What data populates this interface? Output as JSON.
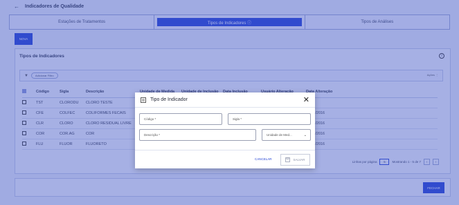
{
  "page": {
    "title": "Indicadores de Qualidade",
    "tabs": [
      {
        "label": "Estações de Tratamentos"
      },
      {
        "label": "Tipos de Indicadores ⓘ"
      },
      {
        "label": "Tipos de Análises"
      }
    ],
    "nova_label": "NOVA",
    "card_title": "Tipos de Indicadores",
    "filter_chip": "Adicionar Filtro",
    "acoes_label": "Ações",
    "columns": [
      "Código",
      "Sigla",
      "Descrição",
      "Unidade de Medida",
      "Unidade de Inclusão",
      "Data Inclusão",
      "Usuário Alteração",
      "Data Alteração"
    ],
    "rows": [
      {
        "codigo": "TST",
        "sigla": "CLORODU",
        "descricao": "CLORO TESTE",
        "data_alteracao": ""
      },
      {
        "codigo": "CFE",
        "sigla": "COLFEC",
        "descricao": "COLIFORMES FECAIS",
        "data_alteracao": "03/11/2016"
      },
      {
        "codigo": "CLR",
        "sigla": "CLORO",
        "descricao": "CLORO RESIDUAL LIVRE",
        "data_alteracao": "03/11/2016"
      },
      {
        "codigo": "COR",
        "sigla": "COR.AG",
        "descricao": "COR",
        "data_alteracao": "03/11/2016"
      },
      {
        "codigo": "FLU",
        "sigla": "FLUOR",
        "descricao": "FLUORETO",
        "data_alteracao": "03/11/2016"
      }
    ],
    "pager": {
      "rows_label": "Linhas por página",
      "page_size": "5",
      "range_label": "Mostrando 1 - 5 de 7"
    },
    "fechar_label": "FECHAR"
  },
  "modal": {
    "title": "Tipo de Indicador",
    "codigo_placeholder": "Código *",
    "sigla_placeholder": "Sigla *",
    "descricao_placeholder": "Descrição *",
    "unidade_placeholder": "Unidade de Med...",
    "cancel_label": "CANCELAR",
    "save_label": "SALVAR"
  }
}
